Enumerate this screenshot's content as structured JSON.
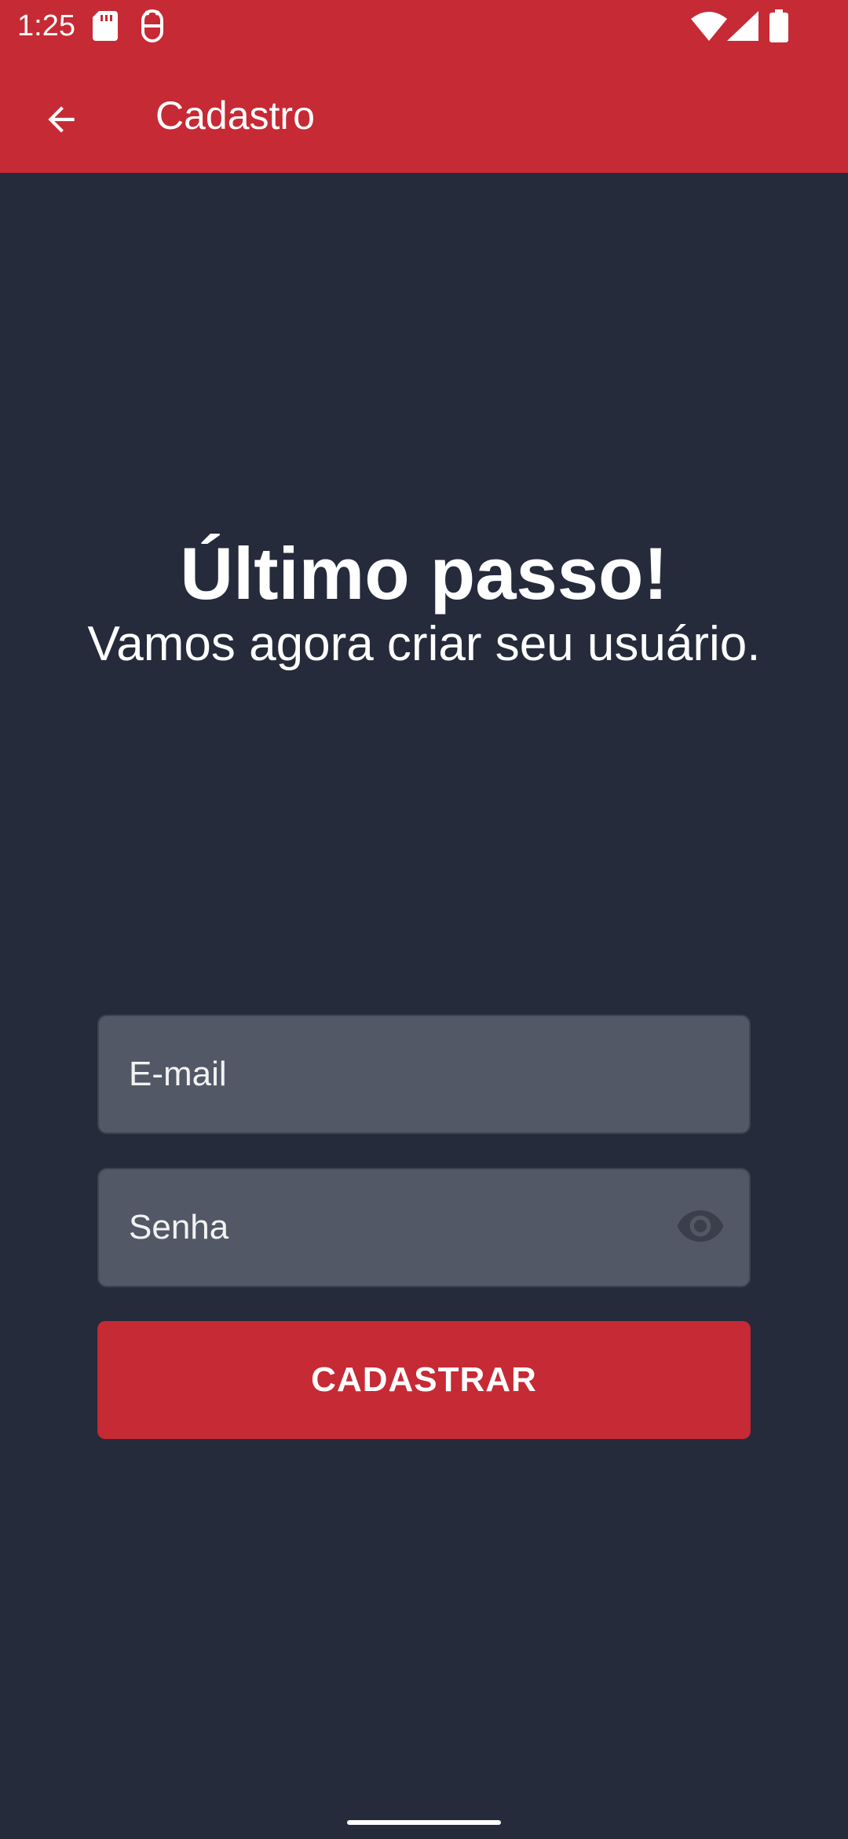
{
  "status_bar": {
    "time": "1:25",
    "icons": [
      "sd-card-icon",
      "android-debug-icon",
      "wifi-icon",
      "cell-signal-icon",
      "battery-icon"
    ]
  },
  "app_bar": {
    "title": "Cadastro",
    "back_icon": "arrow-back-icon",
    "color": "#c62a35"
  },
  "hero": {
    "title": "Último passo!",
    "subtitle": "Vamos agora criar seu usuário."
  },
  "form": {
    "email": {
      "placeholder": "E-mail",
      "value": ""
    },
    "password": {
      "placeholder": "Senha",
      "value": "",
      "toggle_icon": "eye-icon"
    },
    "submit_label": "CADASTRAR"
  },
  "theme": {
    "background": "#252b3b",
    "field_background": "#525866",
    "accent": "#c62a35",
    "text": "#ffffff"
  }
}
